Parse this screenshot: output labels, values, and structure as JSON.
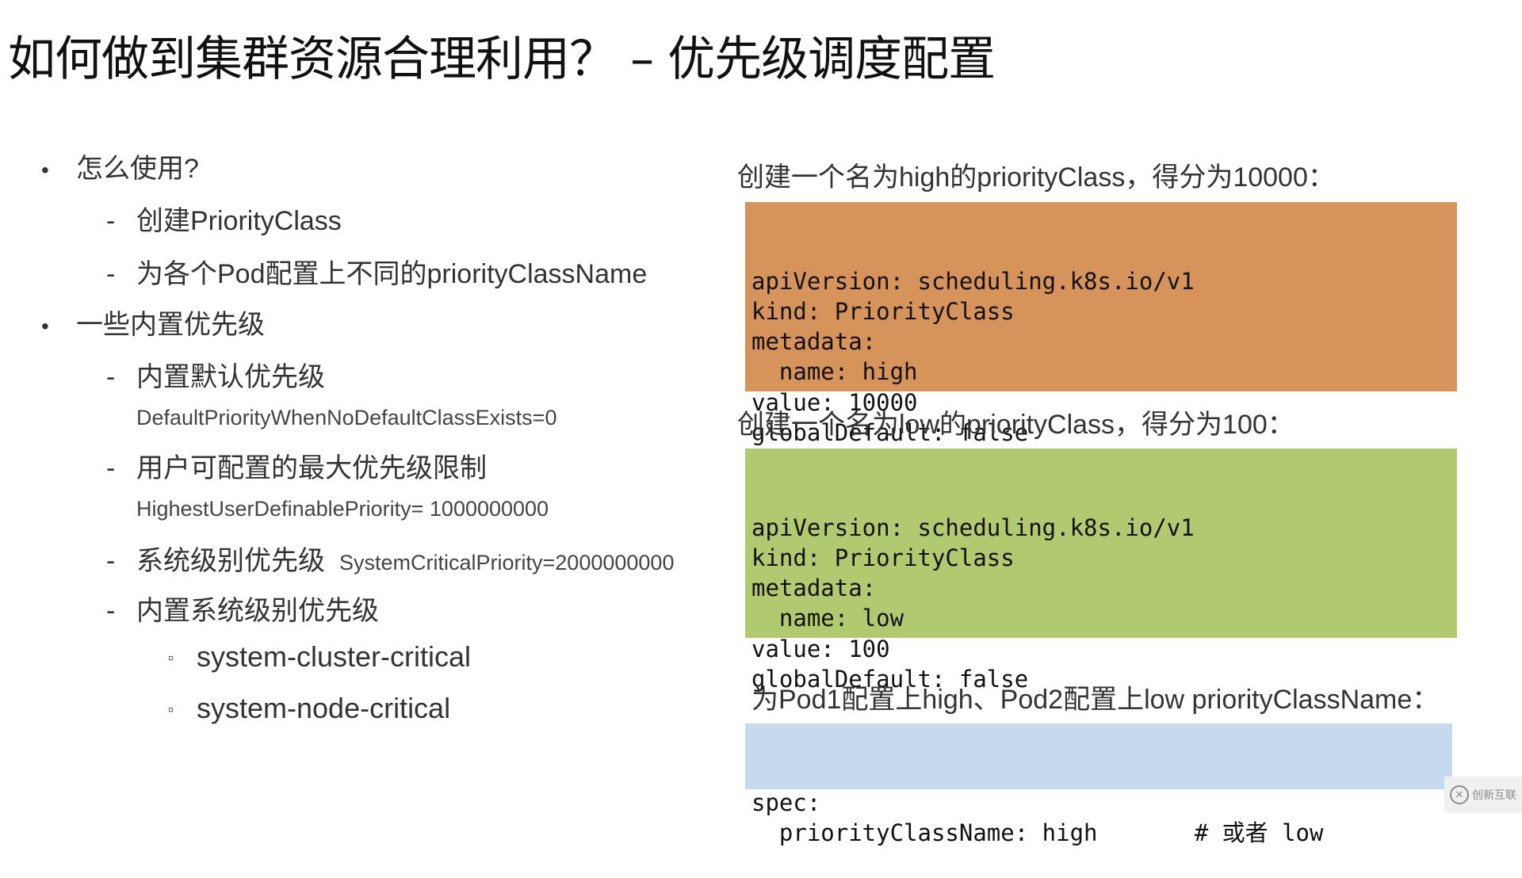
{
  "title": "如何做到集群资源合理利用？ – 优先级调度配置",
  "left": {
    "bullet_marker": "•",
    "dash_marker": "-",
    "square_marker": "▫",
    "sections": [
      {
        "label": "怎么使用?",
        "items": [
          {
            "label": "创建PriorityClass"
          },
          {
            "label": "为各个Pod配置上不同的priorityClassName"
          }
        ]
      },
      {
        "label": "一些内置优先级",
        "items": [
          {
            "label": "内置默认优先级",
            "detail": "DefaultPriorityWhenNoDefaultClassExists=0"
          },
          {
            "label": "用户可配置的最大优先级限制",
            "detail": "HighestUserDefinablePriority= 1000000000"
          },
          {
            "label": "系统级别优先级",
            "inline_detail": "SystemCriticalPriority=2000000000"
          },
          {
            "label": "内置系统级别优先级",
            "subitems": [
              "system-cluster-critical",
              "system-node-critical"
            ]
          }
        ]
      }
    ]
  },
  "right": {
    "high": {
      "caption": "创建一个名为high的priorityClass，得分为10000：",
      "color": "#d6935a",
      "lines": [
        "apiVersion: scheduling.k8s.io/v1",
        "kind: PriorityClass",
        "metadata:",
        "  name: high",
        "value: 10000",
        "globalDefault: false"
      ]
    },
    "low": {
      "caption": "创建一个名为low的priorityClass，得分为100：",
      "color": "#b2ca6f",
      "lines": [
        "apiVersion: scheduling.k8s.io/v1",
        "kind: PriorityClass",
        "metadata:",
        "  name: low",
        "value: 100",
        "globalDefault: false"
      ]
    },
    "pod": {
      "caption": "为Pod1配置上high、Pod2配置上low priorityClassName：",
      "color": "#c7d9ee",
      "lines": [
        "spec:",
        "  priorityClassName: high       # 或者 low"
      ]
    }
  },
  "watermark": {
    "icon": "logo-x-icon",
    "text": "创新互联"
  }
}
